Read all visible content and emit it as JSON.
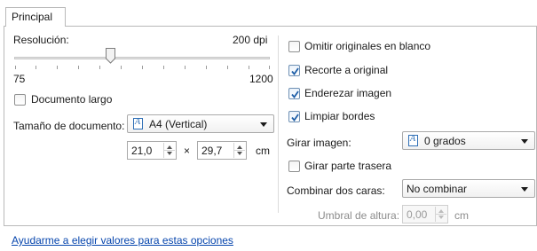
{
  "tabs": [
    {
      "label": "Principal",
      "active": true
    }
  ],
  "resolution": {
    "label": "Resolución:",
    "value_text": "200 dpi",
    "min_label": "75",
    "max_label": "1200",
    "value": 200,
    "min": 75,
    "max": 1200
  },
  "long_document": {
    "label": "Documento largo",
    "checked": false
  },
  "document_size": {
    "label": "Tamaño de documento:",
    "selected": "A4 (Vertical)",
    "icon": "document-portrait-icon",
    "width": "21,0",
    "times": "×",
    "height": "29,7",
    "unit": "cm"
  },
  "options": [
    {
      "label": "Omitir originales en blanco",
      "checked": false
    },
    {
      "label": "Recorte a original",
      "checked": true
    },
    {
      "label": "Enderezar imagen",
      "checked": true
    },
    {
      "label": "Limpiar bordes",
      "checked": true
    }
  ],
  "rotate": {
    "label": "Girar imagen:",
    "selected": "0 grados",
    "icon": "document-portrait-icon",
    "rotate_back_label": "Girar parte trasera",
    "rotate_back_checked": false
  },
  "merge": {
    "label": "Combinar dos caras:",
    "selected": "No combinar",
    "height_threshold_label": "Umbral de altura:",
    "height_threshold_value": "0,00",
    "height_threshold_unit": "cm",
    "height_threshold_enabled": false
  },
  "help_link": "Ayudarme a elegir valores para estas opciones",
  "colors": {
    "accent": "#0645ad",
    "border": "#b9b9b9",
    "check": "#1f5fa8"
  }
}
